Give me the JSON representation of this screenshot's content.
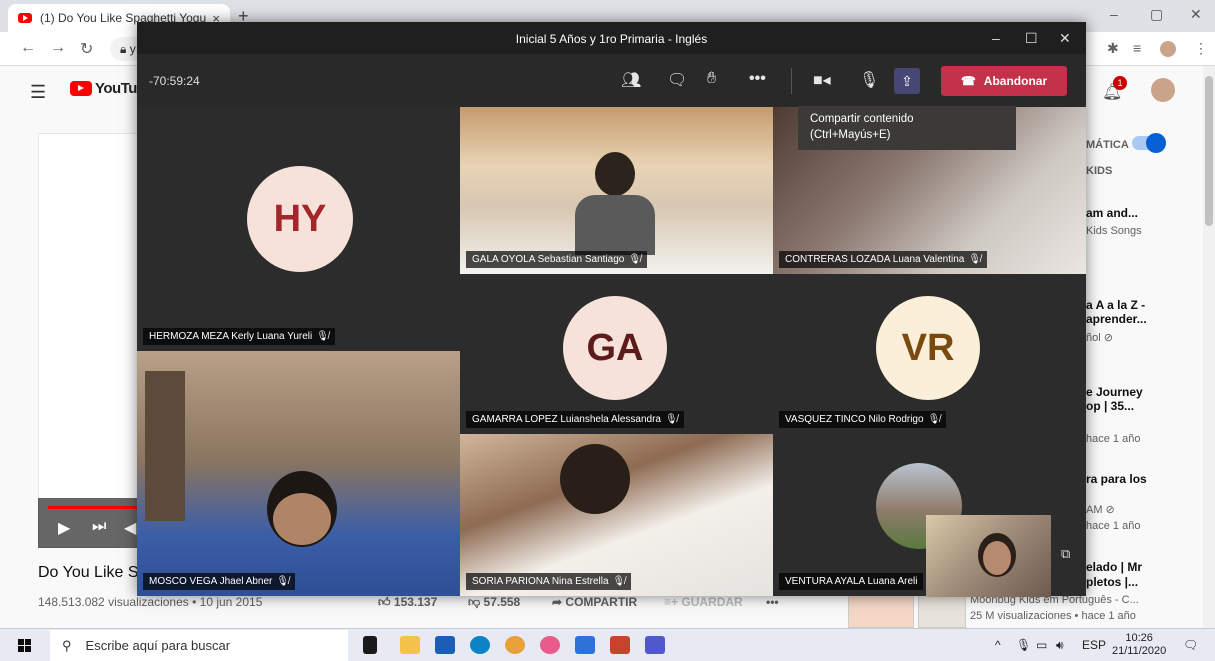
{
  "browser": {
    "tab_title": "(1) Do You Like Spaghetti Yogurt",
    "tab_close": "×",
    "new_tab": "+",
    "address_snippet": "y",
    "win_minimize": "–",
    "win_restore": "▢",
    "win_close": "✕"
  },
  "youtube": {
    "logo_text": "YouTube",
    "video_title": "Do You Like Sp",
    "views": "148.513.082 visualizaciones • 10 jun 2015",
    "likes": "153.137",
    "dislikes": "57.558",
    "share": "COMPARTIR",
    "save": "GUARDAR",
    "more": "•••",
    "notifications_count": "1",
    "sidebar": {
      "autoplay": "MÁTICA",
      "kids": "KIDS",
      "item1_title": "am and...",
      "item1_channel": "Kids Songs",
      "item2_title_l1": "a A a la Z -",
      "item2_title_l2": "aprender...",
      "item2_channel": "ñol ⊘",
      "item3_title_l1": "e Journey",
      "item3_title_l2": "op | 35...",
      "item3_meta": "hace 1 año",
      "item4_title": "ra para los",
      "item4_channel": "AM ⊘",
      "item4_meta": "hace 1 año",
      "item5_title_l1": "elado | Mr",
      "item5_title_l2": "pletos |...",
      "item6_channel": "Moonbug Kids em Português - C...",
      "item6_meta": "25 M visualizaciones • hace 1 año"
    }
  },
  "teams": {
    "window_title": "Inicial 5 Años y 1ro Primaria - Inglés",
    "timer": "-70:59:24",
    "leave_label": "Abandonar",
    "tooltip_line1": "Compartir contenido",
    "tooltip_line2": "(Ctrl+Mayús+E)",
    "more_icon": "•••",
    "participants": {
      "hermoza": {
        "initials": "HY",
        "name": "HERMOZA MEZA Kerly Luana Yureli"
      },
      "gala": {
        "name": "GALA OYOLA Sebastian Santiago"
      },
      "contreras": {
        "name": "CONTRERAS LOZADA Luana Valentina"
      },
      "gamarra": {
        "initials": "GA",
        "name": "GAMARRA LOPEZ Luianshela Alessandra"
      },
      "vasquez": {
        "initials": "VR",
        "name": "VASQUEZ TINCO Nilo Rodrigo"
      },
      "mosco": {
        "name": "MOSCO VEGA Jhael Abner"
      },
      "soria": {
        "name": "SORIA PARIONA Nina Estrella"
      },
      "ventura": {
        "name": "VENTURA AYALA Luana Areli"
      }
    },
    "colors": {
      "avatar_bg": "#f7e2da",
      "hy_text": "#a4262c",
      "ga_text": "#5c1c1c",
      "vr_text": "#7a4b10",
      "leave_red": "#c4314b"
    }
  },
  "taskbar": {
    "search_placeholder": "Escribe aquí para buscar",
    "lang": "ESP",
    "time": "10:26",
    "date": "21/11/2020"
  }
}
